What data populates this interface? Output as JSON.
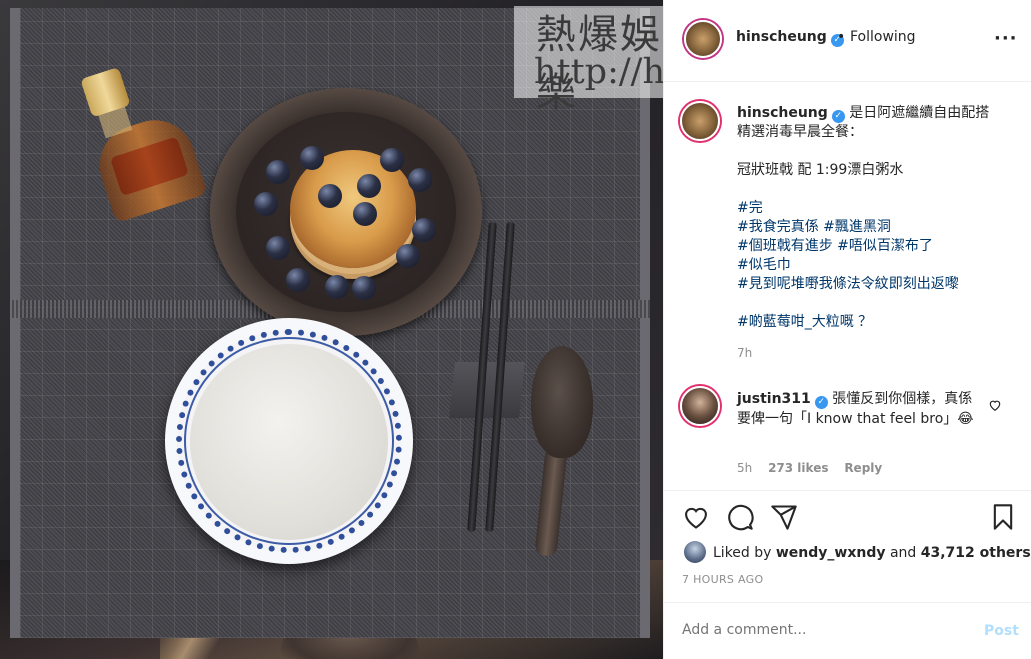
{
  "watermark": {
    "title": "熱爆娛樂",
    "url": "http://hittt.blogspot.com"
  },
  "header": {
    "username": "hinscheung",
    "separator": "•",
    "follow_status": "Following",
    "more_icon": "more-horizontal-icon"
  },
  "caption": {
    "username": "hinscheung",
    "lines": [
      "是日阿遮繼續自由配搭",
      "精選消毒早晨全餐："
    ],
    "menu": "冠狀班戟 配 1:99漂白粥水",
    "hashtags": [
      "#完",
      "#我食完真係 #飄進黑洞",
      "#個班戟有進步 #唔似百潔布了",
      "#似毛巾",
      "#見到呢堆嘢我條法令紋即刻出返嚟"
    ],
    "last": "#啲藍莓咁_大粒嘅 ？",
    "time": "7h"
  },
  "comment": {
    "username": "justin311",
    "text": "張懂反到你個樣，真係要俾一句「I know that feel bro」😂",
    "time": "5h",
    "likes": "273 likes",
    "reply": "Reply"
  },
  "actions": {
    "like_icon": "heart-icon",
    "comment_icon": "comment-icon",
    "share_icon": "send-icon",
    "save_icon": "bookmark-icon"
  },
  "liked_by": {
    "prefix": "Liked by",
    "user": "wendy_wxndy",
    "and": "and",
    "others": "43,712 others"
  },
  "posted_ago": "7 HOURS AGO",
  "add_comment": {
    "placeholder": "Add a comment...",
    "post_label": "Post"
  },
  "colors": {
    "link": "#00376b",
    "verified": "#3897f0",
    "post_disabled": "#b2dffc"
  }
}
